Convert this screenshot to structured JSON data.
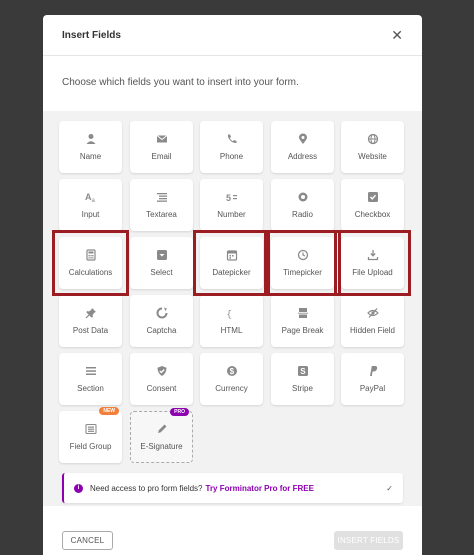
{
  "modal": {
    "title": "Insert Fields",
    "close_glyph": "✕",
    "description": "Choose which fields you want to insert into your form."
  },
  "fields": [
    {
      "label": "Name",
      "icon": "user-icon"
    },
    {
      "label": "Email",
      "icon": "envelope-icon"
    },
    {
      "label": "Phone",
      "icon": "phone-icon"
    },
    {
      "label": "Address",
      "icon": "map-pin-icon"
    },
    {
      "label": "Website",
      "icon": "globe-icon"
    },
    {
      "label": "Input",
      "icon": "text-input-icon"
    },
    {
      "label": "Textarea",
      "icon": "textarea-icon"
    },
    {
      "label": "Number",
      "icon": "number-icon"
    },
    {
      "label": "Radio",
      "icon": "radio-icon"
    },
    {
      "label": "Checkbox",
      "icon": "checkbox-icon"
    },
    {
      "label": "Calculations",
      "icon": "calculator-icon"
    },
    {
      "label": "Select",
      "icon": "dropdown-icon"
    },
    {
      "label": "Datepicker",
      "icon": "calendar-icon"
    },
    {
      "label": "Timepicker",
      "icon": "clock-icon"
    },
    {
      "label": "File Upload",
      "icon": "upload-icon"
    },
    {
      "label": "Post Data",
      "icon": "pin-icon"
    },
    {
      "label": "Captcha",
      "icon": "captcha-icon"
    },
    {
      "label": "HTML",
      "icon": "code-braces-icon"
    },
    {
      "label": "Page Break",
      "icon": "page-break-icon"
    },
    {
      "label": "Hidden Field",
      "icon": "eye-off-icon"
    },
    {
      "label": "Section",
      "icon": "section-icon"
    },
    {
      "label": "Consent",
      "icon": "shield-check-icon"
    },
    {
      "label": "Currency",
      "icon": "currency-icon"
    },
    {
      "label": "Stripe",
      "icon": "stripe-icon"
    },
    {
      "label": "PayPal",
      "icon": "paypal-icon"
    },
    {
      "label": "Field Group",
      "icon": "field-group-icon",
      "badge": "NEW"
    },
    {
      "label": "E-Signature",
      "icon": "pen-icon",
      "badge": "PRO"
    }
  ],
  "highlighted": [
    "Calculations",
    "Datepicker",
    "Timepicker",
    "File Upload"
  ],
  "notice": {
    "text": "Need access to pro form fields?",
    "link": "Try Forminator Pro for FREE"
  },
  "footer": {
    "cancel_label": "CANCEL",
    "insert_label": "INSERT FIELDS"
  },
  "colors": {
    "pro_purple": "#8d00b1",
    "new_orange": "#f0803c",
    "highlight_red": "#9b1c22",
    "icon_gray": "#8a8a8a"
  }
}
